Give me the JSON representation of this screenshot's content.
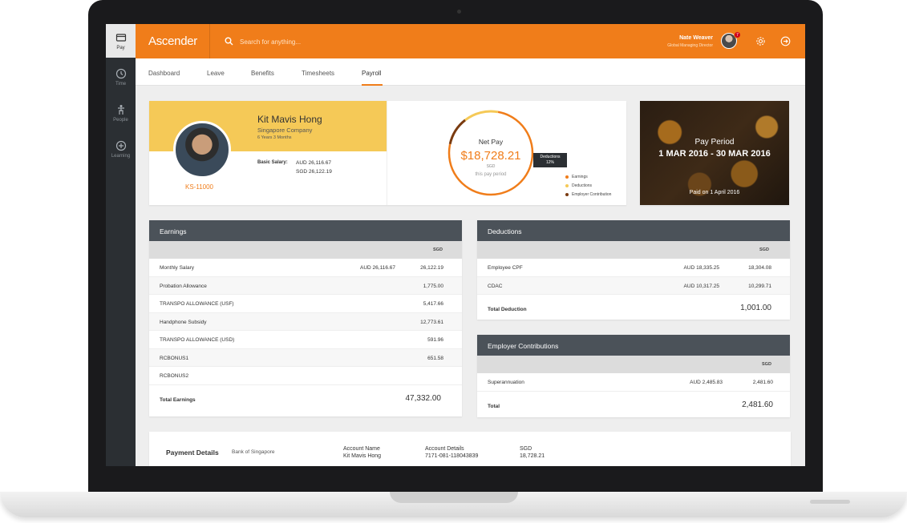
{
  "sidebar": {
    "items": [
      {
        "label": "Pay",
        "icon": "wallet-icon"
      },
      {
        "label": "Time",
        "icon": "clock-icon"
      },
      {
        "label": "People",
        "icon": "person-icon"
      },
      {
        "label": "Learning",
        "icon": "plus-circle-icon"
      }
    ]
  },
  "topbar": {
    "logo": "Ascender",
    "search_placeholder": "Search for anything...",
    "user_name": "Nate Weaver",
    "user_role": "Global Managing Director",
    "badge_count": "7"
  },
  "tabs": [
    "Dashboard",
    "Leave",
    "Benefits",
    "Timesheets",
    "Payroll"
  ],
  "profile": {
    "name": "Kit Mavis Hong",
    "company": "Singapore Company",
    "tenure": "6 Years 3 Months",
    "employee_id": "KS-11000",
    "salary_label": "Basic Salary:",
    "salary_aud": "AUD 26,116.67",
    "salary_sgd": "SGD 26,122.19"
  },
  "net_pay": {
    "label": "Net Pay",
    "value": "$18,728.21",
    "currency": "SGD",
    "sub": "this pay period",
    "tooltip_label": "Deductions",
    "tooltip_value": "12%",
    "legend": [
      {
        "label": "Earnings",
        "color": "#f07d1a"
      },
      {
        "label": "Deductions",
        "color": "#f5c957"
      },
      {
        "label": "Employer Contribution",
        "color": "#7a3b10"
      }
    ]
  },
  "pay_period": {
    "title": "Pay Period",
    "range": "1 MAR 2016 - 30 MAR 2016",
    "paid": "Paid on 1 April 2016"
  },
  "earnings": {
    "title": "Earnings",
    "col": "SGD",
    "rows": [
      {
        "label": "Monthly Salary",
        "aud": "AUD 26,116.67",
        "sgd": "26,122.19"
      },
      {
        "label": "Probation Allowance",
        "aud": "",
        "sgd": "1,775.00"
      },
      {
        "label": "TRANSPO ALLOWANCE (USF)",
        "aud": "",
        "sgd": "5,417.66"
      },
      {
        "label": "Handphone Subsidy",
        "aud": "",
        "sgd": "12,773.61"
      },
      {
        "label": "TRANSPO ALLOWANCE (USD)",
        "aud": "",
        "sgd": "591.96"
      },
      {
        "label": "RCBONUS1",
        "aud": "",
        "sgd": "651.58"
      },
      {
        "label": "RCBONUS2",
        "aud": "",
        "sgd": ""
      }
    ],
    "total_label": "Total Earnings",
    "total": "47,332.00"
  },
  "deductions": {
    "title": "Deductions",
    "col": "SGD",
    "rows": [
      {
        "label": "Employee CPF",
        "aud": "AUD 18,335.25",
        "sgd": "18,304.08"
      },
      {
        "label": "CDAC",
        "aud": "AUD 10,317.25",
        "sgd": "10,299.71"
      }
    ],
    "total_label": "Total Deduction",
    "total": "1,001.00"
  },
  "contributions": {
    "title": "Employer Contributions",
    "col": "SGD",
    "rows": [
      {
        "label": "Superannuation",
        "aud": "AUD 2,485.83",
        "sgd": "2,481.60"
      }
    ],
    "total_label": "Total",
    "total": "2,481.60"
  },
  "payment": {
    "title": "Payment Details",
    "bank": "Bank of Singapore",
    "account_name_h": "Account Name",
    "account_name": "Kit Mavis Hong",
    "account_details_h": "Account Details",
    "account_details": "7171-081-118043839",
    "amount_h": "SGD",
    "amount": "18,728.21"
  }
}
